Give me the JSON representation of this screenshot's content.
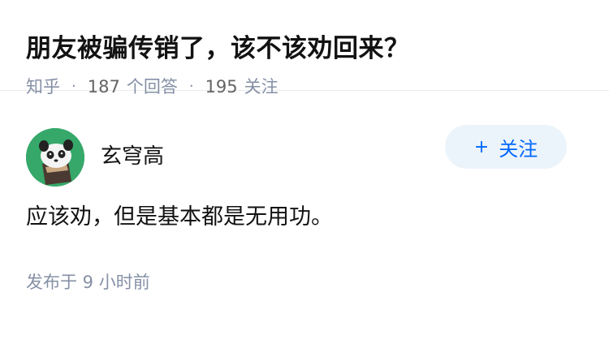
{
  "question": {
    "title": "朋友被骗传销了，该不该劝回来？",
    "source": "知乎",
    "separator": "·",
    "answer_count": "187",
    "answer_label": "个回答",
    "follower_count": "195",
    "follower_label": "关注"
  },
  "answer": {
    "author_name": "玄穹高",
    "follow_plus": "+",
    "follow_label": "关注",
    "content": "应该劝，但是基本都是无用功。",
    "time": "发布于 9 小时前"
  },
  "colors": {
    "accent": "#0066ff",
    "follow_bg": "#ebf4fb",
    "meta_gray": "#8590a6",
    "avatar_bg": "#36a86a"
  }
}
